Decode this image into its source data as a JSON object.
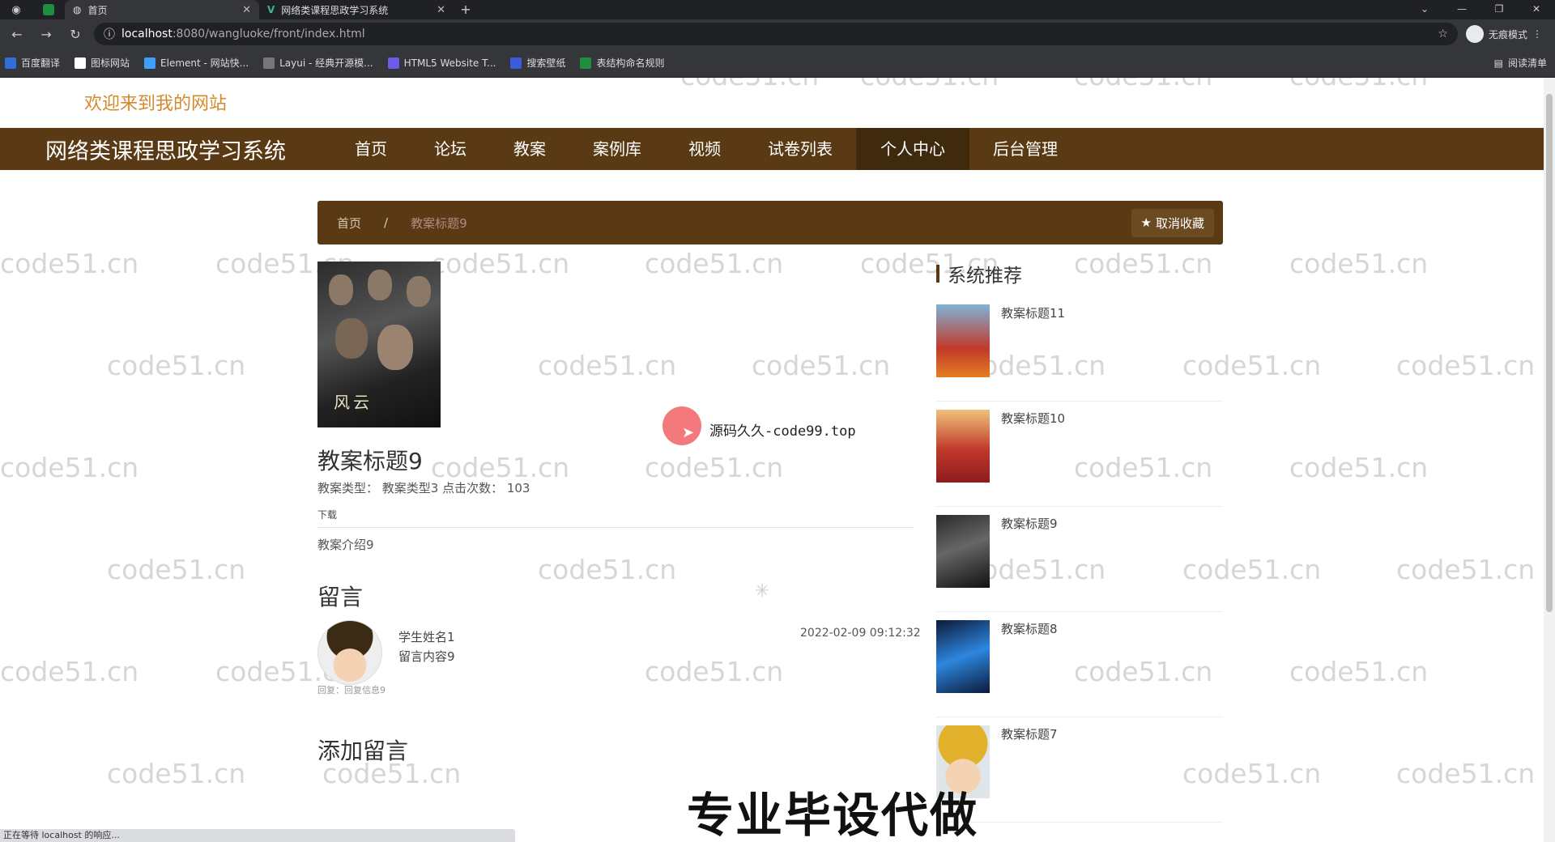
{
  "browser": {
    "tabs": [
      {
        "title": "首页",
        "active": true
      },
      {
        "title": "网络类课程思政学习系统",
        "active": false
      }
    ],
    "url_host": "localhost",
    "url_path": ":8080/wangluoke/front/index.html",
    "profile_label": "无痕模式",
    "bookmarks": [
      "百度翻译",
      "图标网站",
      "Element - 网站快...",
      "Layui - 经典开源模...",
      "HTML5 Website T...",
      "搜索壁纸",
      "表结构命名规则"
    ],
    "reading_list": "阅读清单",
    "status_text": "正在等待 localhost 的响应..."
  },
  "site": {
    "welcome": "欢迎来到我的网站",
    "brand": "网络类课程思政学习系统",
    "nav": [
      "首页",
      "论坛",
      "教案",
      "案例库",
      "视频",
      "试卷列表",
      "个人中心",
      "后台管理"
    ],
    "active_nav": "个人中心"
  },
  "breadcrumb": {
    "home": "首页",
    "separator": "/",
    "current": "教案标题9",
    "favorite_button": "取消收藏"
  },
  "detail": {
    "poster_text": "风云",
    "title": "教案标题9",
    "meta": "教案类型：  教案类型3    点击次数：  103",
    "download": "下载",
    "intro": "教案介绍9"
  },
  "comments": {
    "heading": "留言",
    "items": [
      {
        "name": "学生姓名1",
        "content": "留言内容9",
        "time": "2022-02-09 09:12:32",
        "reply": "回复：回复信息9"
      }
    ],
    "add_heading": "添加留言"
  },
  "recommend": {
    "heading": "系统推荐",
    "items": [
      "教案标题11",
      "教案标题10",
      "教案标题9",
      "教案标题8",
      "教案标题7"
    ]
  },
  "overlay": {
    "source_label": "源码久久-code99.top",
    "banner": "专业毕设代做",
    "watermark": "code51.cn"
  },
  "colors": {
    "nav_bg": "#5a3a14",
    "welcome": "#d28a2e",
    "cursor_highlight": "#f26a6f"
  }
}
